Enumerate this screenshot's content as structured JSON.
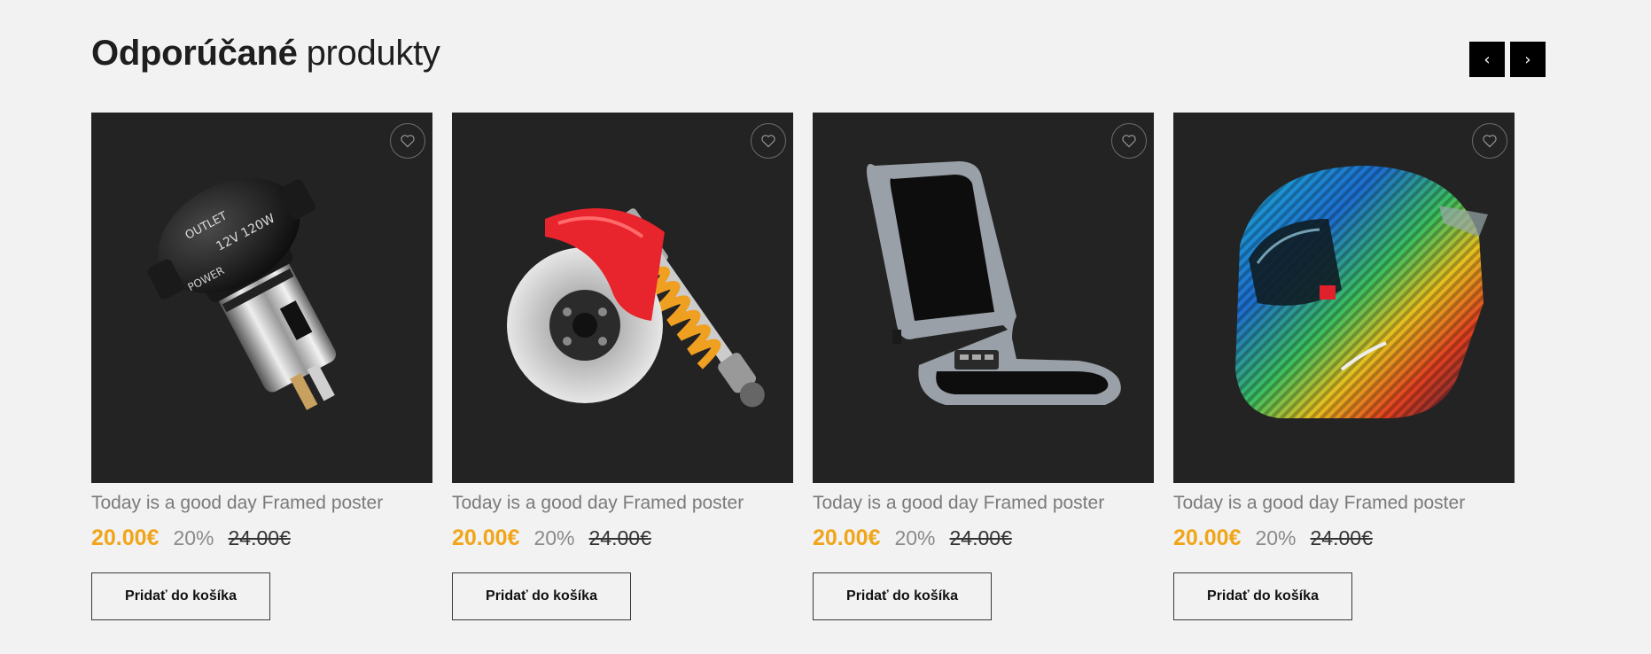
{
  "section": {
    "title_bold": "Odporúčané",
    "title_light": "produkty"
  },
  "nav": {
    "prev": "‹",
    "next": "›"
  },
  "products": [
    {
      "image": "car-power-outlet",
      "title": "Today is a good day Framed poster",
      "price": "20.00€",
      "discount": "20%",
      "old_price": "24.00€",
      "button": "Pridať do košíka"
    },
    {
      "image": "brake-disc-shock-absorber",
      "title": "Today is a good day Framed poster",
      "price": "20.00€",
      "discount": "20%",
      "old_price": "24.00€",
      "button": "Pridať do košíka"
    },
    {
      "image": "massage-seat-cushion",
      "title": "Today is a good day Framed poster",
      "price": "20.00€",
      "discount": "20%",
      "old_price": "24.00€",
      "button": "Pridať do košíka"
    },
    {
      "image": "motorcycle-helmet",
      "title": "Today is a good day Framed poster",
      "price": "20.00€",
      "discount": "20%",
      "old_price": "24.00€",
      "button": "Pridať do košíka"
    }
  ],
  "product_image_text": {
    "outlet_top": "OUTLET",
    "outlet_voltage": "12V 120W",
    "outlet_bottom": "POWER"
  },
  "colors": {
    "accent_price": "#f0a51a",
    "card_bg": "#232323",
    "page_bg": "#f2f2f2",
    "nav_btn": "#000000"
  }
}
